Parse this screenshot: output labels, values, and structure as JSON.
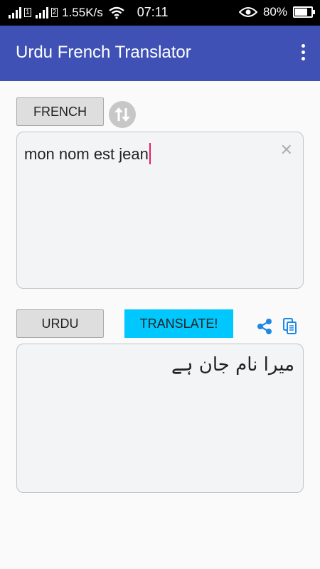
{
  "status_bar": {
    "speed": "1.55K/s",
    "time": "07:11",
    "battery": "80%"
  },
  "app_bar": {
    "title": "Urdu French Translator",
    "menu_icon": "more-vert-icon"
  },
  "source": {
    "language_label": "FRENCH",
    "text": "mon nom est jean",
    "swap_icon": "swap-vert-icon",
    "clear_icon": "close-icon"
  },
  "target": {
    "language_label": "URDU",
    "translate_label": "TRANSLATE!",
    "share_icon": "share-icon",
    "copy_icon": "copy-icon",
    "text": "میرا نام جان ہے"
  },
  "colors": {
    "app_bar": "#3f51b5",
    "translate_button": "#00c8ff",
    "caret": "#e91e63",
    "icon_blue": "#1e88e5"
  }
}
